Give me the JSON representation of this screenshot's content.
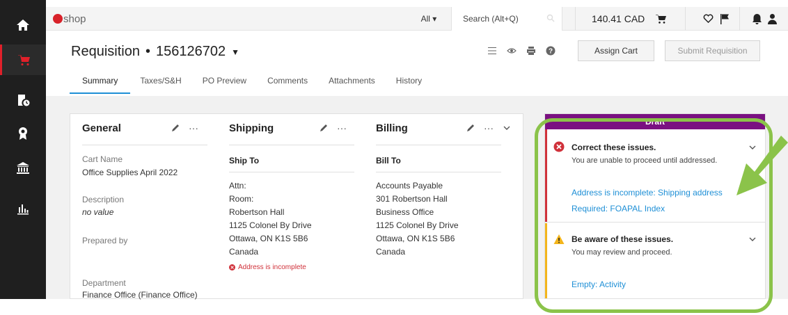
{
  "app": {
    "logo_text": "shop"
  },
  "topbar": {
    "scope": "All ▾",
    "search_placeholder": "Search (Alt+Q)",
    "cart_total": "140.41 CAD"
  },
  "header": {
    "title": "Requisition",
    "separator": "•",
    "number": "156126702",
    "assign_label": "Assign Cart",
    "submit_label": "Submit Requisition"
  },
  "tabs": [
    {
      "label": "Summary"
    },
    {
      "label": "Taxes/S&H"
    },
    {
      "label": "PO Preview"
    },
    {
      "label": "Comments"
    },
    {
      "label": "Attachments"
    },
    {
      "label": "History"
    }
  ],
  "general": {
    "title": "General",
    "cart_name_label": "Cart Name",
    "cart_name_value": "Office Supplies April 2022",
    "description_label": "Description",
    "description_value": "no value",
    "prepared_by_label": "Prepared by",
    "department_label": "Department",
    "department_value": "Finance Office (Finance Office)"
  },
  "shipping": {
    "title": "Shipping",
    "ship_to_label": "Ship To",
    "lines": [
      "Attn:",
      "Room:",
      "Robertson Hall",
      "1125 Colonel By Drive",
      "Ottawa, ON K1S 5B6",
      "Canada"
    ],
    "error": "Address is incomplete"
  },
  "billing": {
    "title": "Billing",
    "bill_to_label": "Bill To",
    "lines": [
      "Accounts Payable",
      "301 Robertson Hall",
      "Business Office",
      "1125 Colonel By Drive",
      "Ottawa, ON K1S 5B6",
      "Canada"
    ]
  },
  "status_panel": {
    "status": "Draft",
    "errors": {
      "title": "Correct these issues.",
      "description": "You are unable to proceed until addressed.",
      "links": [
        "Address is incomplete: Shipping address",
        "Required: FOAPAL Index"
      ]
    },
    "warnings": {
      "title": "Be aware of these issues.",
      "description": "You may review and proceed.",
      "links": [
        "Empty: Activity"
      ]
    }
  },
  "colors": {
    "accent": "#1e8fd6",
    "draft": "#7a1181",
    "error": "#d0313a",
    "warning": "#f3b51b",
    "annotation": "#8bc34a"
  }
}
